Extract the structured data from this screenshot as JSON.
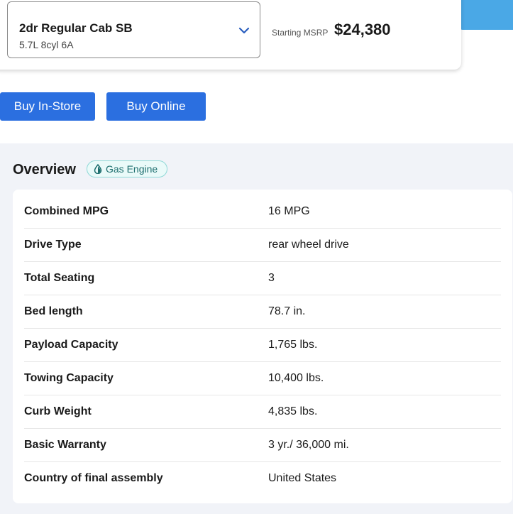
{
  "trim": {
    "name": "2dr Regular Cab SB",
    "engine": "5.7L 8cyl 6A"
  },
  "msrp": {
    "label": "Starting MSRP",
    "value": "$24,380"
  },
  "buttons": {
    "buy_in_store": "Buy In-Store",
    "buy_online": "Buy Online"
  },
  "overview": {
    "title": "Overview",
    "badge": "Gas Engine",
    "specs": [
      {
        "label": "Combined MPG",
        "value": "16 MPG"
      },
      {
        "label": "Drive Type",
        "value": "rear wheel drive"
      },
      {
        "label": "Total Seating",
        "value": "3"
      },
      {
        "label": "Bed length",
        "value": "78.7 in."
      },
      {
        "label": "Payload Capacity",
        "value": "1,765 lbs."
      },
      {
        "label": "Towing Capacity",
        "value": "10,400 lbs."
      },
      {
        "label": "Curb Weight",
        "value": "4,835 lbs."
      },
      {
        "label": "Basic Warranty",
        "value": "3 yr./ 36,000 mi."
      },
      {
        "label": "Country of final assembly",
        "value": "United States"
      }
    ]
  },
  "colors": {
    "primary_button": "#2b6fe0",
    "accent_shape": "#4aa8e6",
    "badge_text": "#1d6e6e",
    "section_bg": "#f1f3f8"
  },
  "icons": {
    "dropdown": "chevron-down-icon",
    "fuel": "droplet-icon"
  }
}
